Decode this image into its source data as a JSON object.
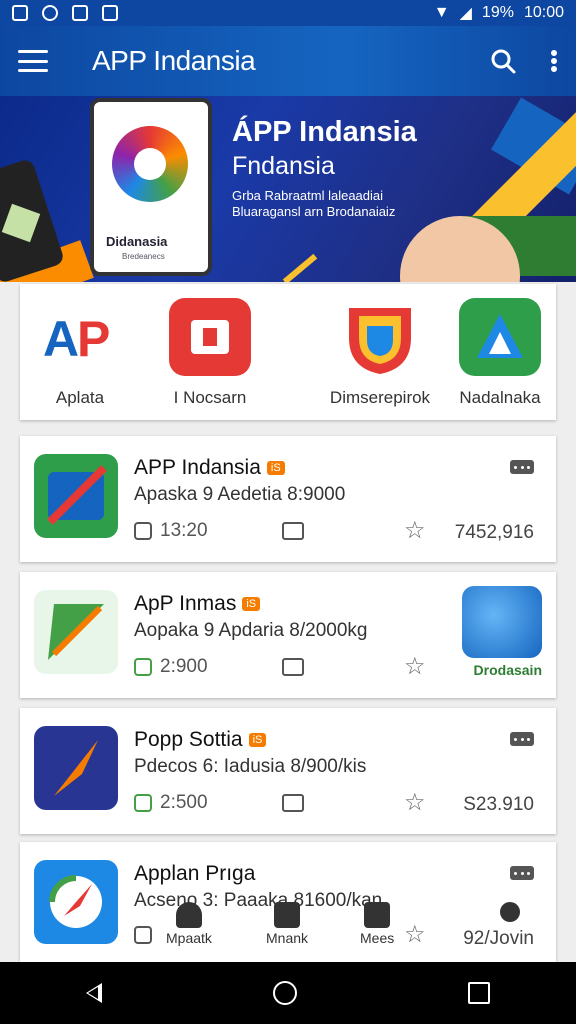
{
  "status_bar": {
    "battery": "19%",
    "time": "10:00"
  },
  "app_bar": {
    "title": "APP Indansia"
  },
  "banner": {
    "heading": "ÁPP Indansia",
    "subheading": "Fndansia",
    "line1": "Grba Rabraatml laleaadiai",
    "line2": "Bluaragansl arn Brodanaiaiz",
    "phone_caption": "Didanasia",
    "phone_sub": "Bredeanecs"
  },
  "featured": {
    "items": [
      {
        "label": "Aplata",
        "icon": "ap-logo-icon"
      },
      {
        "label": "I Nocsarn",
        "icon": "red-puzzle-icon"
      },
      {
        "label": "Dimserepirok",
        "icon": "colorful-shield-icon"
      },
      {
        "label": "Nadalnaka",
        "icon": "green-triangle-icon"
      }
    ]
  },
  "apps": [
    {
      "title": "APP Indansia",
      "badge": "iS",
      "desc": "Apaska 9 Aedetia 8:9000",
      "time": "13:20",
      "stat": "7452,916"
    },
    {
      "title": "ApP Inmas",
      "badge": "iS",
      "desc": "Aopaka 9 Apdaria 8/2000kg",
      "time": "2:900",
      "side_label": "Drodasain"
    },
    {
      "title": "Popp Sottia",
      "badge": "iS",
      "desc": "Pdecos 6: Iadusia 8/900/kis",
      "time": "2:500",
      "stat": "S23.910"
    },
    {
      "title": "Applan Prıga",
      "desc": "Acseno 3: Paaaka 81600/kan",
      "stat": "92/Jovin"
    }
  ],
  "bottom_nav": {
    "items": [
      {
        "label": "Mpaatk",
        "icon": "fire-icon"
      },
      {
        "label": "Mnank",
        "icon": "grid-icon"
      },
      {
        "label": "Mees",
        "icon": "mail-icon"
      }
    ]
  },
  "colors": {
    "primary": "#0d47a1",
    "accent": "#f57c00"
  }
}
